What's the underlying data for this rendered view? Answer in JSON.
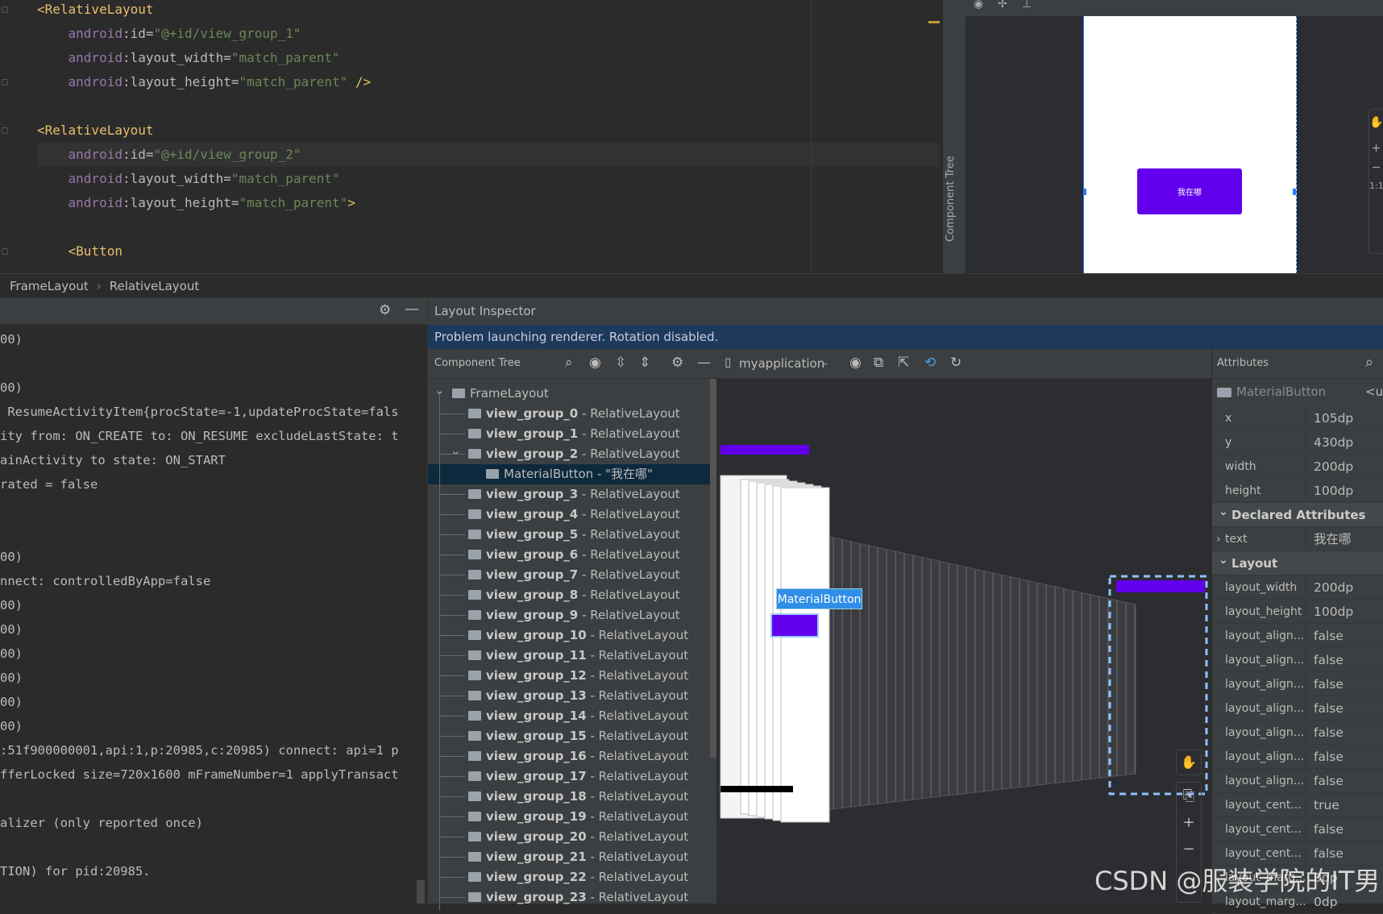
{
  "editor": {
    "lines": [
      {
        "hl": false,
        "fold": true,
        "segs": [
          {
            "t": "<RelativeLayout",
            "c": "tag"
          }
        ]
      },
      {
        "hl": false,
        "segs": [
          {
            "t": "    android",
            "c": "ns"
          },
          {
            "t": ":id=",
            "c": "at"
          },
          {
            "t": "\"@+id/view_group_1\"",
            "c": "val"
          }
        ]
      },
      {
        "hl": false,
        "segs": [
          {
            "t": "    android",
            "c": "ns"
          },
          {
            "t": ":layout_width=",
            "c": "at"
          },
          {
            "t": "\"match_parent\"",
            "c": "val"
          }
        ]
      },
      {
        "hl": false,
        "fold": true,
        "segs": [
          {
            "t": "    android",
            "c": "ns"
          },
          {
            "t": ":layout_height=",
            "c": "at"
          },
          {
            "t": "\"match_parent\"",
            "c": "val"
          },
          {
            "t": " />",
            "c": "tag"
          }
        ]
      },
      {
        "hl": false,
        "segs": []
      },
      {
        "hl": false,
        "fold": true,
        "segs": [
          {
            "t": "<RelativeLayout",
            "c": "tag"
          }
        ]
      },
      {
        "hl": true,
        "segs": [
          {
            "t": "    android",
            "c": "ns"
          },
          {
            "t": ":id=",
            "c": "at"
          },
          {
            "t": "\"@+id/view_group_2\"",
            "c": "val"
          }
        ]
      },
      {
        "hl": false,
        "segs": [
          {
            "t": "    android",
            "c": "ns"
          },
          {
            "t": ":layout_width=",
            "c": "at"
          },
          {
            "t": "\"match_parent\"",
            "c": "val"
          }
        ]
      },
      {
        "hl": false,
        "segs": [
          {
            "t": "    android",
            "c": "ns"
          },
          {
            "t": ":layout_height=",
            "c": "at"
          },
          {
            "t": "\"match_parent\"",
            "c": "val"
          },
          {
            "t": ">",
            "c": "tag"
          }
        ]
      },
      {
        "hl": false,
        "segs": []
      },
      {
        "hl": false,
        "fold": true,
        "segs": [
          {
            "t": "    <Button",
            "c": "tag"
          }
        ]
      }
    ]
  },
  "design": {
    "side_label": "Component Tree",
    "button_text": "我在哪",
    "accent": "#6200ee",
    "zoom_label": "1:1"
  },
  "breadcrumb": [
    "FrameLayout",
    "RelativeLayout"
  ],
  "log": {
    "lines": [
      "00)",
      "",
      "00)",
      " ResumeActivityItem{procState=-1,updateProcState=fals",
      "ity from: ON_CREATE to: ON_RESUME excludeLastState: t",
      "ainActivity to state: ON_START",
      "rated = false",
      "",
      "",
      "00)",
      "nnect: controlledByApp=false",
      "00)",
      "00)",
      "00)",
      "00)",
      "00)",
      "00)",
      ":51f900000001,api:1,p:20985,c:20985) connect: api=1 p",
      "fferLocked size=720x1600 mFrameNumber=1 applyTransact",
      "",
      "alizer (only reported once)",
      "",
      "TION) for pid:20985."
    ]
  },
  "inspector": {
    "title": "Layout Inspector",
    "banner": "Problem launching renderer. Rotation disabled.",
    "tree_label": "Component Tree",
    "process": "myapplication",
    "tooltip": "MaterialButton",
    "tree": [
      {
        "name": "FrameLayout",
        "type": "",
        "level": 0,
        "expanded": true
      },
      {
        "name": "view_group_0",
        "type": "RelativeLayout",
        "level": 1
      },
      {
        "name": "view_group_1",
        "type": "RelativeLayout",
        "level": 1
      },
      {
        "name": "view_group_2",
        "type": "RelativeLayout",
        "level": 1,
        "expanded": true
      },
      {
        "name": "MaterialButton - \"我在哪\"",
        "type": "",
        "level": 2,
        "selected": true
      },
      {
        "name": "view_group_3",
        "type": "RelativeLayout",
        "level": 1
      },
      {
        "name": "view_group_4",
        "type": "RelativeLayout",
        "level": 1
      },
      {
        "name": "view_group_5",
        "type": "RelativeLayout",
        "level": 1
      },
      {
        "name": "view_group_6",
        "type": "RelativeLayout",
        "level": 1
      },
      {
        "name": "view_group_7",
        "type": "RelativeLayout",
        "level": 1
      },
      {
        "name": "view_group_8",
        "type": "RelativeLayout",
        "level": 1
      },
      {
        "name": "view_group_9",
        "type": "RelativeLayout",
        "level": 1
      },
      {
        "name": "view_group_10",
        "type": "RelativeLayout",
        "level": 1
      },
      {
        "name": "view_group_11",
        "type": "RelativeLayout",
        "level": 1
      },
      {
        "name": "view_group_12",
        "type": "RelativeLayout",
        "level": 1
      },
      {
        "name": "view_group_13",
        "type": "RelativeLayout",
        "level": 1
      },
      {
        "name": "view_group_14",
        "type": "RelativeLayout",
        "level": 1
      },
      {
        "name": "view_group_15",
        "type": "RelativeLayout",
        "level": 1
      },
      {
        "name": "view_group_16",
        "type": "RelativeLayout",
        "level": 1
      },
      {
        "name": "view_group_17",
        "type": "RelativeLayout",
        "level": 1
      },
      {
        "name": "view_group_18",
        "type": "RelativeLayout",
        "level": 1
      },
      {
        "name": "view_group_19",
        "type": "RelativeLayout",
        "level": 1
      },
      {
        "name": "view_group_20",
        "type": "RelativeLayout",
        "level": 1
      },
      {
        "name": "view_group_21",
        "type": "RelativeLayout",
        "level": 1
      },
      {
        "name": "view_group_22",
        "type": "RelativeLayout",
        "level": 1
      },
      {
        "name": "view_group_23",
        "type": "RelativeLayout",
        "level": 1
      }
    ],
    "attributes": {
      "title": "Attributes",
      "component": "MaterialButton",
      "component_id": "<un",
      "rows": [
        {
          "k": "x",
          "v": "105dp"
        },
        {
          "k": "y",
          "v": "430dp"
        },
        {
          "k": "width",
          "v": "200dp"
        },
        {
          "k": "height",
          "v": "100dp"
        },
        {
          "section": "Declared Attributes"
        },
        {
          "k": "text",
          "v": "我在哪",
          "expandable": true
        },
        {
          "section": "Layout"
        },
        {
          "k": "layout_width",
          "v": "200dp"
        },
        {
          "k": "layout_height",
          "v": "100dp"
        },
        {
          "k": "layout_align...",
          "v": "false"
        },
        {
          "k": "layout_align...",
          "v": "false"
        },
        {
          "k": "layout_align...",
          "v": "false"
        },
        {
          "k": "layout_align...",
          "v": "false"
        },
        {
          "k": "layout_align...",
          "v": "false"
        },
        {
          "k": "layout_align...",
          "v": "false"
        },
        {
          "k": "layout_align...",
          "v": "false"
        },
        {
          "k": "layout_cent...",
          "v": "true"
        },
        {
          "k": "layout_cent...",
          "v": "false"
        },
        {
          "k": "layout_cent...",
          "v": "false"
        },
        {
          "k": "layout_marg...",
          "v": "0dp"
        },
        {
          "k": "layout_marg...",
          "v": "0dp"
        }
      ]
    }
  },
  "watermark": "CSDN @服装学院的IT男"
}
